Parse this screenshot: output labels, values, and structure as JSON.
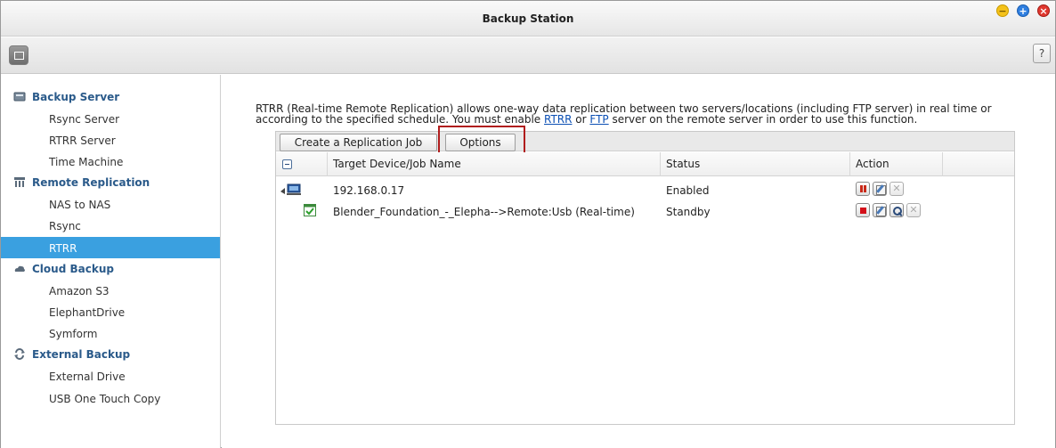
{
  "window": {
    "title": "Backup Station",
    "help_label": "?",
    "min_glyph": "−",
    "max_glyph": "+",
    "close_glyph": "×"
  },
  "sidebar": {
    "sections": [
      {
        "label": "Backup Server",
        "icon": "server-icon",
        "items": [
          "Rsync Server",
          "RTRR Server",
          "Time Machine"
        ]
      },
      {
        "label": "Remote Replication",
        "icon": "replication-icon",
        "items": [
          "NAS to NAS",
          "Rsync",
          "RTRR"
        ]
      },
      {
        "label": "Cloud Backup",
        "icon": "cloud-icon",
        "items": [
          "Amazon S3",
          "ElephantDrive",
          "Symform"
        ]
      },
      {
        "label": "External Backup",
        "icon": "sync-icon",
        "items": [
          "External Drive",
          "USB One Touch Copy"
        ]
      }
    ],
    "active_item": "RTRR"
  },
  "main": {
    "description_pre": "RTRR (Real-time Remote Replication) allows one-way data replication between two servers/locations (including FTP server) in real time or according to the specified schedule. You must enable ",
    "link_rtrr": "RTRR",
    "description_mid": " or ",
    "link_ftp": "FTP",
    "description_post": " server on the remote server in order to use this function.",
    "buttons": {
      "create": "Create a Replication Job",
      "options": "Options"
    },
    "table": {
      "headers": [
        "Target Device/Job Name",
        "Status",
        "Action"
      ],
      "rows": [
        {
          "name": "192.168.0.17",
          "status": "Enabled",
          "actions": [
            "pause",
            "edit",
            "delete"
          ]
        },
        {
          "name": "Blender_Foundation_-_Elepha-->Remote:Usb (Real-time)",
          "status": "Standby",
          "actions": [
            "stop",
            "edit",
            "log",
            "delete"
          ]
        }
      ]
    }
  },
  "colors": {
    "accent": "#3aa0e0",
    "section_label": "#2a5a8a",
    "link": "#0b4fb4",
    "highlight": "#b01c1c"
  }
}
